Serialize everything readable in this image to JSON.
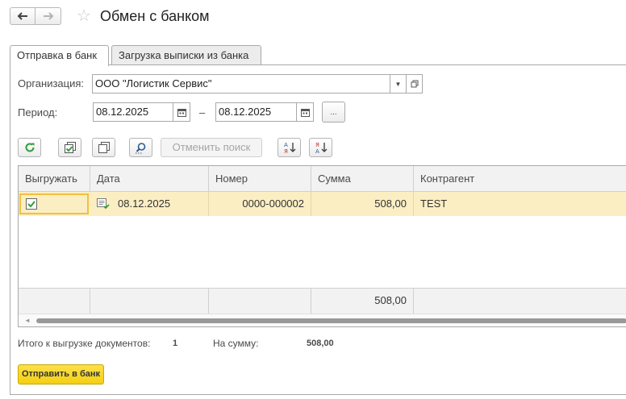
{
  "header": {
    "title": "Обмен с банком"
  },
  "tabs": [
    {
      "label": "Отправка в банк",
      "active": true
    },
    {
      "label": "Загрузка выписки из банка",
      "active": false
    }
  ],
  "form": {
    "org_label": "Организация:",
    "org_value": "ООО \"Логистик Сервис\"",
    "period_label": "Период:",
    "date_from": "08.12.2025",
    "date_to": "08.12.2025",
    "dash": "–",
    "period_btn": "..."
  },
  "toolbar": {
    "cancel_search": "Отменить поиск"
  },
  "table": {
    "columns": [
      "Выгружать",
      "Дата",
      "Номер",
      "Сумма",
      "Контрагент"
    ],
    "rows": [
      {
        "export": true,
        "date": "08.12.2025",
        "number": "0000-000002",
        "sum": "508,00",
        "counterparty": "TEST"
      }
    ],
    "footer_sum": "508,00"
  },
  "summary": {
    "docs_label": "Итого к выгрузке документов:",
    "docs_count": "1",
    "sum_label": "На сумму:",
    "sum_value": "508,00"
  },
  "actions": {
    "send_label": "Отправить в банк"
  },
  "colors": {
    "accent_yellow": "#f4cf11",
    "row_highlight": "#fbeec3",
    "refresh_green": "#2e9e3a"
  }
}
